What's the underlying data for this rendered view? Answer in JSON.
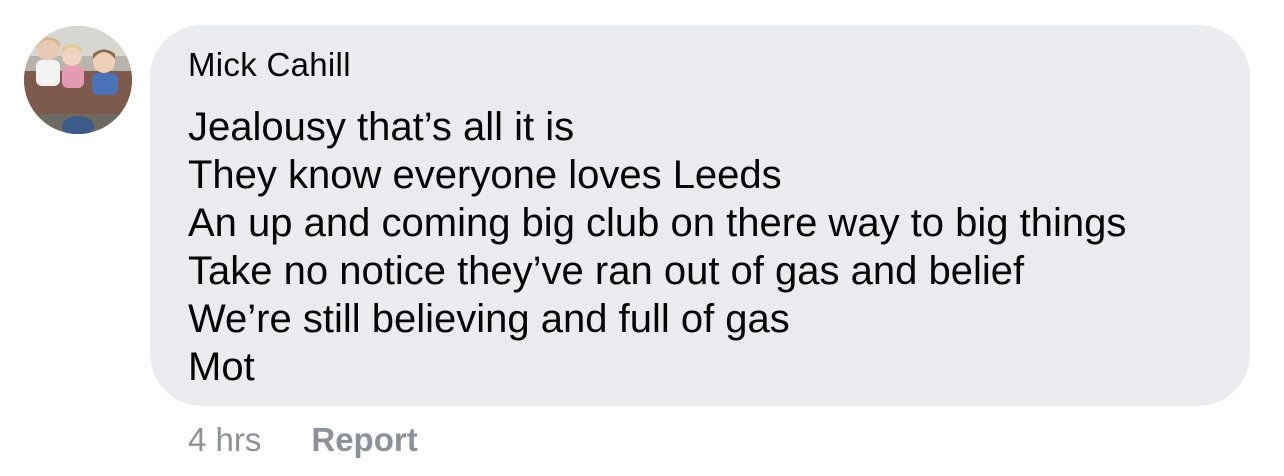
{
  "comment": {
    "author": "Mick Cahill",
    "avatar_icon": "profile-photo-children-icon",
    "lines": [
      "Jealousy that’s all it is",
      "They know everyone loves Leeds",
      "An up and coming big club on there way to big things",
      "Take no notice they’ve ran out of gas and belief",
      "We’re still believing and full of gas",
      "Mot"
    ],
    "timestamp": "4 hrs",
    "report_label": "Report"
  },
  "colors": {
    "bubble_bg": "#eaebef",
    "text": "#050505",
    "meta_text": "#8d9199"
  }
}
